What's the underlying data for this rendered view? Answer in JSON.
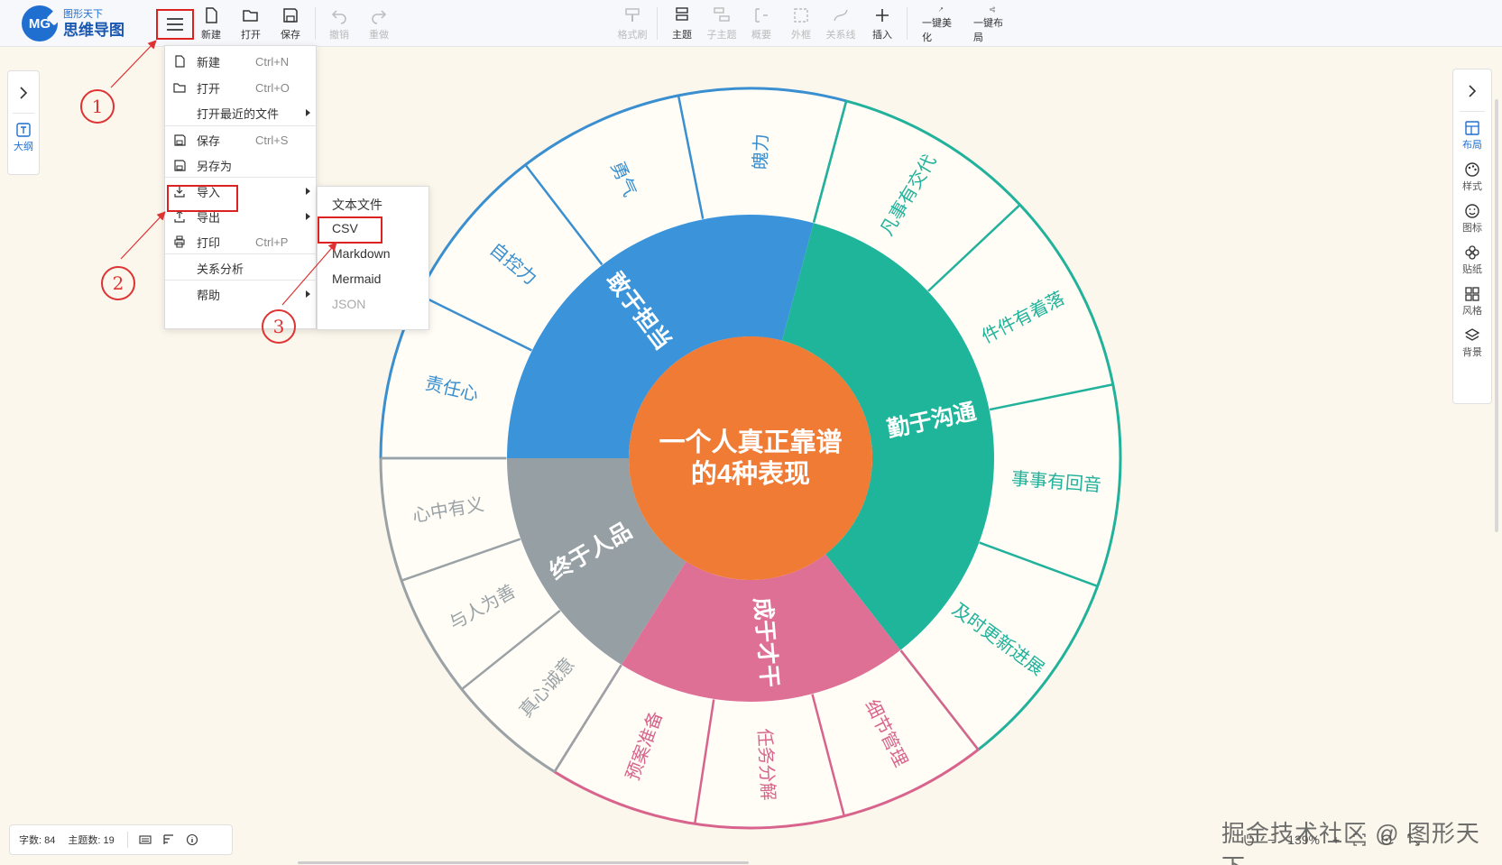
{
  "app": {
    "logo_sub": "图形天下",
    "logo_main": "思维导图",
    "logo_mark": "MG"
  },
  "toolbar": {
    "new": "新建",
    "open": "打开",
    "save": "保存",
    "undo": "撤销",
    "redo": "重做",
    "format_painter": "格式刷",
    "topic": "主题",
    "subtopic": "子主题",
    "summary": "概要",
    "boundary": "外框",
    "relation": "关系线",
    "insert": "插入",
    "beautify": "一键美化",
    "layout": "一键布局"
  },
  "file_menu": {
    "items": [
      {
        "label": "新建",
        "shortcut": "Ctrl+N",
        "icon": "file-icon"
      },
      {
        "label": "打开",
        "shortcut": "Ctrl+O",
        "icon": "folder-icon"
      },
      {
        "label": "打开最近的文件",
        "shortcut": "",
        "icon": ""
      },
      {
        "label": "保存",
        "shortcut": "Ctrl+S",
        "icon": "save-icon"
      },
      {
        "label": "另存为",
        "shortcut": "",
        "icon": "save-as-icon"
      },
      {
        "label": "导入",
        "shortcut": "",
        "icon": "import-icon"
      },
      {
        "label": "导出",
        "shortcut": "",
        "icon": "export-icon"
      },
      {
        "label": "打印",
        "shortcut": "Ctrl+P",
        "icon": "print-icon"
      },
      {
        "label": "关系分析",
        "shortcut": "",
        "icon": ""
      },
      {
        "label": "帮助",
        "shortcut": "",
        "icon": ""
      }
    ]
  },
  "import_submenu": {
    "items": [
      "文本文件",
      "CSV",
      "Markdown",
      "Mermaid",
      "JSON"
    ]
  },
  "annotations": [
    "1",
    "2",
    "3"
  ],
  "left_panel": {
    "outline": "大纲"
  },
  "right_panel": {
    "layout": "布局",
    "style": "样式",
    "icon": "图标",
    "sticker": "贴纸",
    "theme": "风格",
    "background": "背景"
  },
  "mindmap": {
    "center_line1": "一个人真正靠谱",
    "center_line2": "的4种表现",
    "branches": [
      "敢于担当",
      "勤于沟通",
      "成于才干",
      "终于人品"
    ],
    "leaves_blue": [
      "魄力",
      "勇气",
      "自控力",
      "责任心"
    ],
    "leaves_green": [
      "凡事有交代",
      "件件有着落",
      "事事有回音",
      "及时更新进展"
    ],
    "leaves_pink": [
      "细节管理",
      "任务分解",
      "预案准备"
    ],
    "leaves_gray": [
      "真心诚意",
      "与人为善",
      "心中有义"
    ],
    "colors": {
      "center": "#ef7b35",
      "blue": "#3b94d9",
      "green": "#1fb59a",
      "pink": "#df7095",
      "gray": "#969fa4",
      "blue_line": "#3a8fd0",
      "green_line": "#22b29b",
      "pink_line": "#d8648d",
      "gray_line": "#9aa2a6"
    }
  },
  "status": {
    "word_count": "字数: 84",
    "topic_count": "主题数: 19",
    "zoom": "139%"
  },
  "watermark": "掘金技术社区 @ 图形天下"
}
